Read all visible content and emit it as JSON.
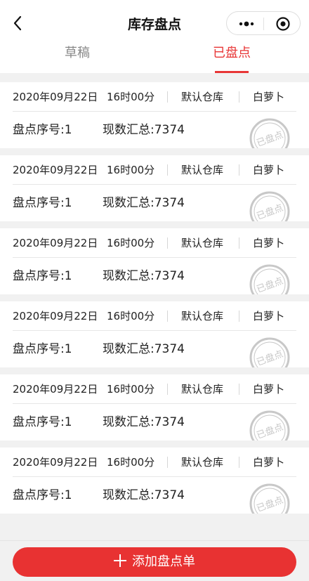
{
  "nav": {
    "title": "库存盘点"
  },
  "tabs": [
    {
      "label": "草稿",
      "active": false
    },
    {
      "label": "已盘点",
      "active": true
    }
  ],
  "records": [
    {
      "date": "2020年09月22日",
      "time": "16时00分",
      "warehouse": "默认仓库",
      "user": "白萝卜",
      "seq": "盘点序号:1",
      "total": "现数汇总:7374",
      "stamp": "已盘点"
    },
    {
      "date": "2020年09月22日",
      "time": "16时00分",
      "warehouse": "默认仓库",
      "user": "白萝卜",
      "seq": "盘点序号:1",
      "total": "现数汇总:7374",
      "stamp": "已盘点"
    },
    {
      "date": "2020年09月22日",
      "time": "16时00分",
      "warehouse": "默认仓库",
      "user": "白萝卜",
      "seq": "盘点序号:1",
      "total": "现数汇总:7374",
      "stamp": "已盘点"
    },
    {
      "date": "2020年09月22日",
      "time": "16时00分",
      "warehouse": "默认仓库",
      "user": "白萝卜",
      "seq": "盘点序号:1",
      "total": "现数汇总:7374",
      "stamp": "已盘点"
    },
    {
      "date": "2020年09月22日",
      "time": "16时00分",
      "warehouse": "默认仓库",
      "user": "白萝卜",
      "seq": "盘点序号:1",
      "total": "现数汇总:7374",
      "stamp": "已盘点"
    },
    {
      "date": "2020年09月22日",
      "time": "16时00分",
      "warehouse": "默认仓库",
      "user": "白萝卜",
      "seq": "盘点序号:1",
      "total": "现数汇总:7374",
      "stamp": "已盘点"
    }
  ],
  "bottom": {
    "add_label": "添加盘点单"
  },
  "colors": {
    "accent": "#e83636",
    "button": "#e83232",
    "background": "#f1f1f1",
    "stamp": "#c8c8c8"
  },
  "icons": {
    "back": "chevron-left-icon",
    "more": "more-dots-icon",
    "close": "target-circle-icon",
    "add": "plus-icon",
    "stamp": "completed-stamp-icon"
  }
}
